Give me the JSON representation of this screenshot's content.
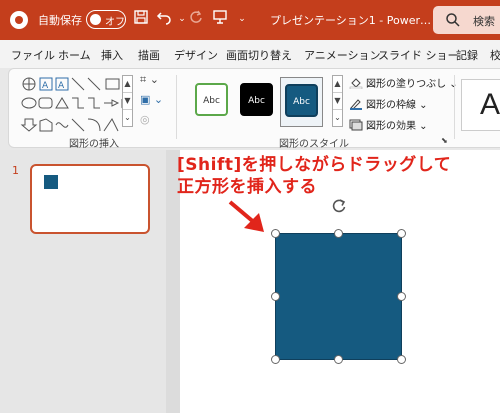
{
  "titlebar": {
    "autosave_label": "自動保存",
    "autosave_state": "オフ",
    "doc_title": "プレゼンテーション1 - Power…",
    "search_label": "検索",
    "accent_color": "#c43e1c"
  },
  "menu": {
    "tabs": [
      "ファイル",
      "ホーム",
      "挿入",
      "描画",
      "デザイン",
      "画面切り替え",
      "アニメーション",
      "スライド ショー",
      "記録",
      "校"
    ]
  },
  "ribbon": {
    "insert_shapes_label": "図形の挿入",
    "shape_styles_label": "図形のスタイル",
    "style_tiles": [
      {
        "label": "Abc",
        "fill": "#ffffff",
        "border": "#5ca84a",
        "text": "#333333"
      },
      {
        "label": "Abc",
        "fill": "#000000",
        "border": "#000000",
        "text": "#ffffff"
      },
      {
        "label": "Abc",
        "fill": "#155a80",
        "border": "#0f3f5c",
        "text": "#ffffff"
      }
    ],
    "fill_label": "図形の塗りつぶし",
    "outline_label": "図形の枠線",
    "effects_label": "図形の効果",
    "wordart_preview": "A"
  },
  "slides_panel": {
    "slide_number": "1"
  },
  "annotation": {
    "line1": "[Shift]を押しながらドラッグして",
    "line2": "正方形を挿入する",
    "color": "#e1251b"
  },
  "shape": {
    "fill_color": "#155a80"
  }
}
